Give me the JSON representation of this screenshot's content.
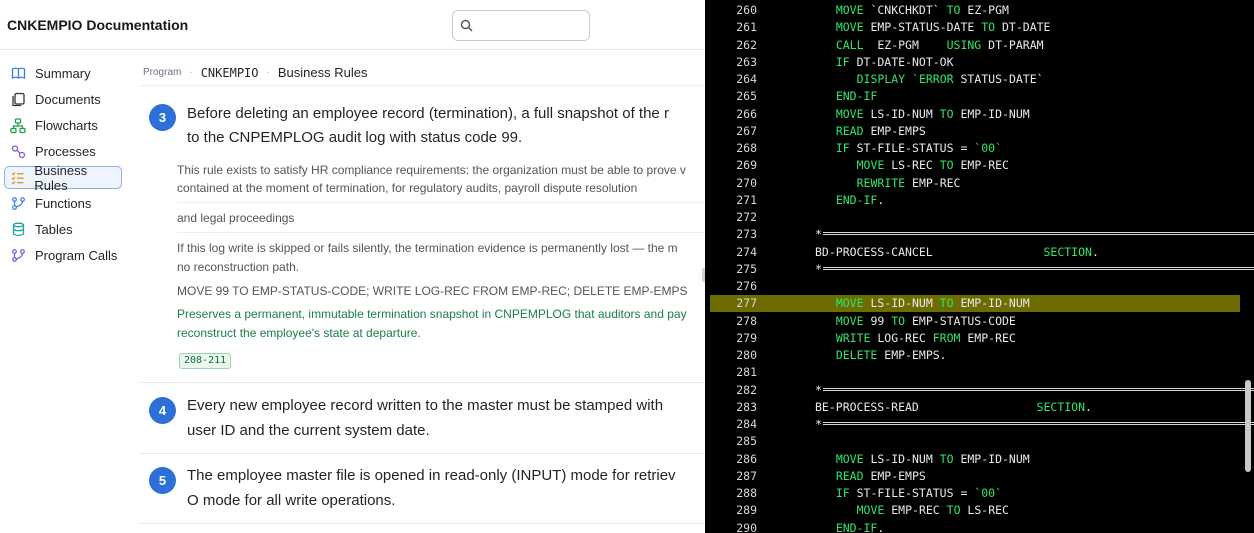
{
  "header": {
    "program_name": "CNKEMPIO",
    "title_suffix": " Documentation",
    "search_placeholder": ""
  },
  "sidebar": {
    "items": [
      {
        "label": "Summary",
        "icon": "book-icon"
      },
      {
        "label": "Documents",
        "icon": "documents-icon"
      },
      {
        "label": "Flowcharts",
        "icon": "flowchart-icon"
      },
      {
        "label": "Processes",
        "icon": "processes-icon"
      },
      {
        "label": "Business Rules",
        "icon": "list-icon",
        "active": true
      },
      {
        "label": "Functions",
        "icon": "function-icon"
      },
      {
        "label": "Tables",
        "icon": "database-icon"
      },
      {
        "label": "Program Calls",
        "icon": "program-calls-icon"
      }
    ]
  },
  "breadcrumb": {
    "root": "Program",
    "program": "CNKEMPIO",
    "page": "Business Rules",
    "sep": "·"
  },
  "rules": [
    {
      "number": "3",
      "title_lines": [
        "Before deleting an employee record (termination), a full snapshot of the r",
        "to the CNPEMPLOG audit log with status code 99."
      ],
      "rationale_lines": [
        "This rule exists to satisfy HR compliance requirements: the organization must be able to prove v",
        "contained at the moment of termination, for regulatory audits, payroll dispute resolution"
      ],
      "rationale_extra": "and legal proceedings",
      "risk_lines": [
        "If this log write is skipped or fails silently, the termination evidence is permanently lost — the m",
        "no reconstruction path."
      ],
      "implementation": "MOVE 99 TO EMP-STATUS-CODE; WRITE LOG-REC FROM EMP-REC; DELETE EMP-EMPS",
      "effect_lines": [
        "Preserves a permanent, immutable termination snapshot in CNPEMPLOG that auditors and pay",
        "reconstruct the employee's state at departure."
      ],
      "lines": "208-211"
    },
    {
      "number": "4",
      "title_lines": [
        "Every new employee record written to the master must be stamped with",
        "user ID and the current system date."
      ]
    },
    {
      "number": "5",
      "title_lines": [
        "The employee master file is opened in read-only (INPUT) mode for retriev",
        "O mode for all write operations."
      ]
    }
  ],
  "code": {
    "highlighted_line": "277",
    "lines": [
      {
        "n": "260",
        "t": [
          [
            "k",
            "MOVE "
          ],
          [
            "v",
            "`CNKCHKDT`"
          ],
          [
            "k",
            " TO "
          ],
          [
            "v",
            "EZ-PGM"
          ]
        ],
        "indent": 3
      },
      {
        "n": "261",
        "t": [
          [
            "k",
            "MOVE "
          ],
          [
            "v",
            "EMP-STATUS-DATE"
          ],
          [
            "k",
            " TO "
          ],
          [
            "v",
            "DT-DATE"
          ]
        ],
        "indent": 3
      },
      {
        "n": "262",
        "t": [
          [
            "k",
            "CALL  "
          ],
          [
            "v",
            "EZ-PGM"
          ],
          [
            "k",
            "    USING "
          ],
          [
            "v",
            "DT-PARAM"
          ]
        ],
        "indent": 3
      },
      {
        "n": "263",
        "t": [
          [
            "k",
            "IF "
          ],
          [
            "v",
            "DT-DATE-NOT-OK"
          ]
        ],
        "indent": 3
      },
      {
        "n": "264",
        "t": [
          [
            "k",
            "DISPLAY "
          ],
          [
            "k",
            "`ERROR "
          ],
          [
            "v",
            "STATUS-DATE`"
          ]
        ],
        "indent": 6
      },
      {
        "n": "265",
        "t": [
          [
            "k",
            "END-IF"
          ]
        ],
        "indent": 3
      },
      {
        "n": "266",
        "t": [
          [
            "k",
            "MOVE "
          ],
          [
            "v",
            "LS-ID-NUM"
          ],
          [
            "k",
            " TO "
          ],
          [
            "v",
            "EMP-ID-NUM"
          ]
        ],
        "indent": 3
      },
      {
        "n": "267",
        "t": [
          [
            "k",
            "READ "
          ],
          [
            "v",
            "EMP-EMPS"
          ]
        ],
        "indent": 3
      },
      {
        "n": "268",
        "t": [
          [
            "k",
            "IF "
          ],
          [
            "v",
            "ST-FILE-STATUS = "
          ],
          [
            "k",
            "`00`"
          ]
        ],
        "indent": 3
      },
      {
        "n": "269",
        "t": [
          [
            "k",
            "MOVE "
          ],
          [
            "v",
            "LS-REC"
          ],
          [
            "k",
            " TO "
          ],
          [
            "v",
            "EMP-REC"
          ]
        ],
        "indent": 6
      },
      {
        "n": "270",
        "t": [
          [
            "k",
            "REWRITE "
          ],
          [
            "v",
            "EMP-REC"
          ]
        ],
        "indent": 6
      },
      {
        "n": "271",
        "t": [
          [
            "k",
            "END-IF"
          ],
          [
            "v",
            "."
          ]
        ],
        "indent": 3
      },
      {
        "n": "272",
        "t": []
      },
      {
        "n": "273",
        "divider": true
      },
      {
        "n": "274",
        "t": [
          [
            "v",
            "BD-PROCESS-CANCEL"
          ],
          [
            "k",
            "                SECTION"
          ],
          [
            "v",
            "."
          ]
        ],
        "indent": 0
      },
      {
        "n": "275",
        "divider": true
      },
      {
        "n": "276",
        "t": []
      },
      {
        "n": "277",
        "t": [
          [
            "k",
            "MOVE "
          ],
          [
            "v",
            "LS-ID-NUM"
          ],
          [
            "k",
            " TO "
          ],
          [
            "v",
            "EMP-ID-NUM"
          ]
        ],
        "indent": 3
      },
      {
        "n": "278",
        "t": [
          [
            "k",
            "MOVE "
          ],
          [
            "v",
            "99"
          ],
          [
            "k",
            " TO "
          ],
          [
            "v",
            "EMP-STATUS-CODE"
          ]
        ],
        "indent": 3
      },
      {
        "n": "279",
        "t": [
          [
            "k",
            "WRITE "
          ],
          [
            "v",
            "LOG-REC"
          ],
          [
            "k",
            " FROM "
          ],
          [
            "v",
            "EMP-REC"
          ]
        ],
        "indent": 3
      },
      {
        "n": "280",
        "t": [
          [
            "k",
            "DELETE "
          ],
          [
            "v",
            "EMP-EMPS."
          ]
        ],
        "indent": 3
      },
      {
        "n": "281",
        "t": []
      },
      {
        "n": "282",
        "divider": true
      },
      {
        "n": "283",
        "t": [
          [
            "v",
            "BE-PROCESS-READ"
          ],
          [
            "k",
            "                 SECTION"
          ],
          [
            "v",
            "."
          ]
        ],
        "indent": 0
      },
      {
        "n": "284",
        "divider": true
      },
      {
        "n": "285",
        "t": []
      },
      {
        "n": "286",
        "t": [
          [
            "k",
            "MOVE "
          ],
          [
            "v",
            "LS-ID-NUM"
          ],
          [
            "k",
            " TO "
          ],
          [
            "v",
            "EMP-ID-NUM"
          ]
        ],
        "indent": 3
      },
      {
        "n": "287",
        "t": [
          [
            "k",
            "READ "
          ],
          [
            "v",
            "EMP-EMPS"
          ]
        ],
        "indent": 3
      },
      {
        "n": "288",
        "t": [
          [
            "k",
            "IF "
          ],
          [
            "v",
            "ST-FILE-STATUS = "
          ],
          [
            "k",
            "`00`"
          ]
        ],
        "indent": 3
      },
      {
        "n": "289",
        "t": [
          [
            "k",
            "MOVE "
          ],
          [
            "v",
            "EMP-REC"
          ],
          [
            "k",
            " TO "
          ],
          [
            "v",
            "LS-REC"
          ]
        ],
        "indent": 6
      },
      {
        "n": "290",
        "t": [
          [
            "k",
            "END-IF"
          ],
          [
            "v",
            "."
          ]
        ],
        "indent": 3
      }
    ]
  }
}
